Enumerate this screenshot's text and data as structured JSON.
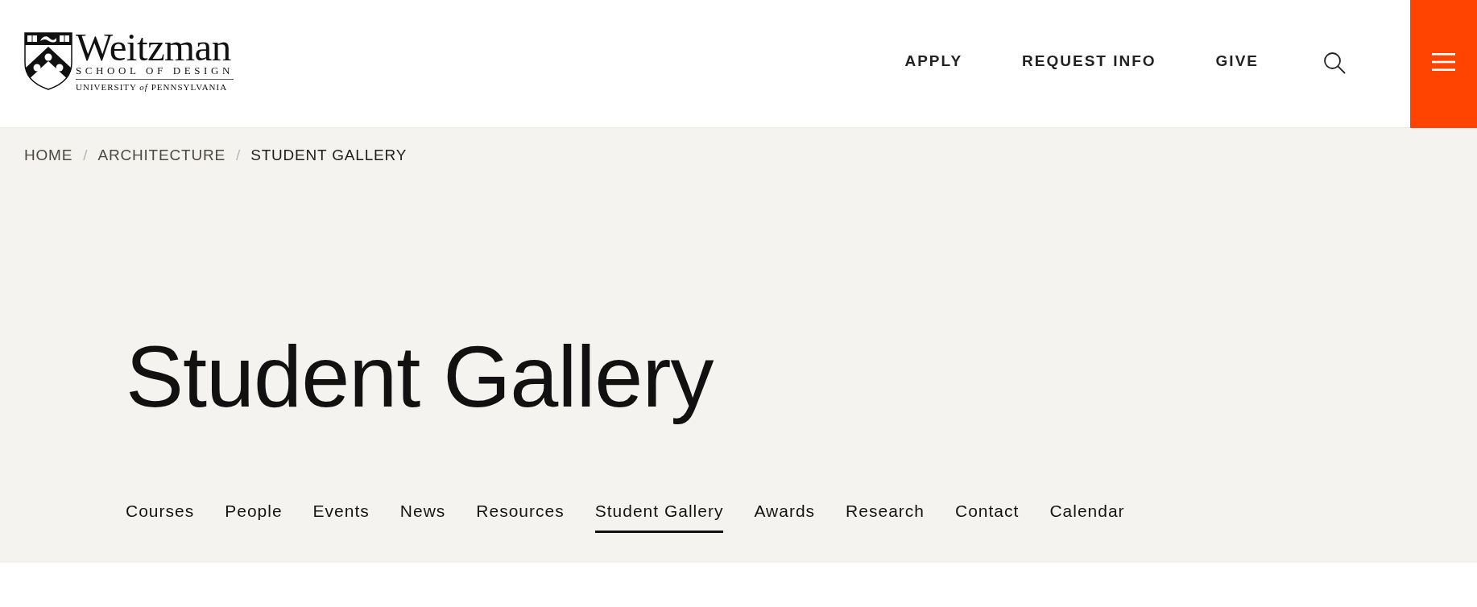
{
  "header": {
    "logo": {
      "name": "Weitzman",
      "school": "SCHOOL OF DESIGN",
      "university": "UNIVERSITY *of* PENNSYLVANIA"
    },
    "nav": [
      {
        "label": "APPLY"
      },
      {
        "label": "REQUEST INFO"
      },
      {
        "label": "GIVE"
      }
    ]
  },
  "breadcrumb": [
    {
      "kind": "link",
      "label": "HOME",
      "current": false
    },
    {
      "kind": "separator",
      "label": "/"
    },
    {
      "kind": "link",
      "label": "ARCHITECTURE",
      "current": false
    },
    {
      "kind": "separator",
      "label": "/"
    },
    {
      "kind": "link",
      "label": "STUDENT GALLERY",
      "current": true
    }
  ],
  "page_title": "Student Gallery",
  "subnav": [
    {
      "label": "Courses",
      "selected": false
    },
    {
      "label": "People",
      "selected": false
    },
    {
      "label": "Events",
      "selected": false
    },
    {
      "label": "News",
      "selected": false
    },
    {
      "label": "Resources",
      "selected": false
    },
    {
      "label": "Student Gallery",
      "selected": true
    },
    {
      "label": "Awards",
      "selected": false
    },
    {
      "label": "Research",
      "selected": false
    },
    {
      "label": "Contact",
      "selected": false
    },
    {
      "label": "Calendar",
      "selected": false
    }
  ]
}
